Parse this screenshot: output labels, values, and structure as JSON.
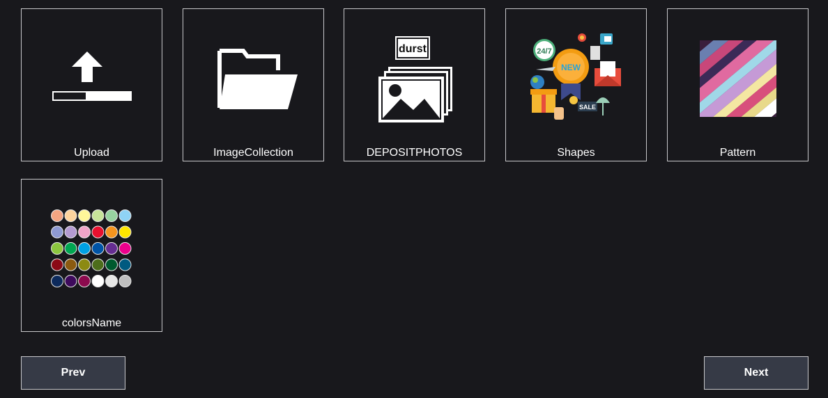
{
  "tiles": [
    {
      "label": "Upload",
      "icon": "upload-icon"
    },
    {
      "label": "ImageCollection",
      "icon": "folder-icon"
    },
    {
      "label": "DEPOSITPHOTOS",
      "icon": "image-stack-icon",
      "badge": "durst"
    },
    {
      "label": "Shapes",
      "icon": "shapes-collage-icon",
      "art_text": [
        "24/7",
        "NEW",
        "SALE"
      ]
    },
    {
      "label": "Pattern",
      "icon": "pattern-swatch-icon"
    },
    {
      "label": "colorsName",
      "icon": "color-palette-icon"
    }
  ],
  "palette": [
    [
      "#f4a582",
      "#fdd49e",
      "#fff79a",
      "#c7e39a",
      "#97d3a0",
      "#8fd3f5"
    ],
    [
      "#8f9ad3",
      "#b49bd1",
      "#f0a4c8",
      "#e8102f",
      "#f5951f",
      "#ffe600"
    ],
    [
      "#8cc63f",
      "#00a651",
      "#00a0e3",
      "#0054a6",
      "#662d91",
      "#ec008c"
    ],
    [
      "#8b0a16",
      "#8b5a10",
      "#8c8a12",
      "#4d6d1b",
      "#005a2e",
      "#005a80"
    ],
    [
      "#0d2a5c",
      "#3d0a5c",
      "#8c0a4e",
      "#ffffff",
      "#e6e6e6",
      "#bfbfbf"
    ]
  ],
  "pagination": {
    "prev": "Prev",
    "next": "Next"
  }
}
